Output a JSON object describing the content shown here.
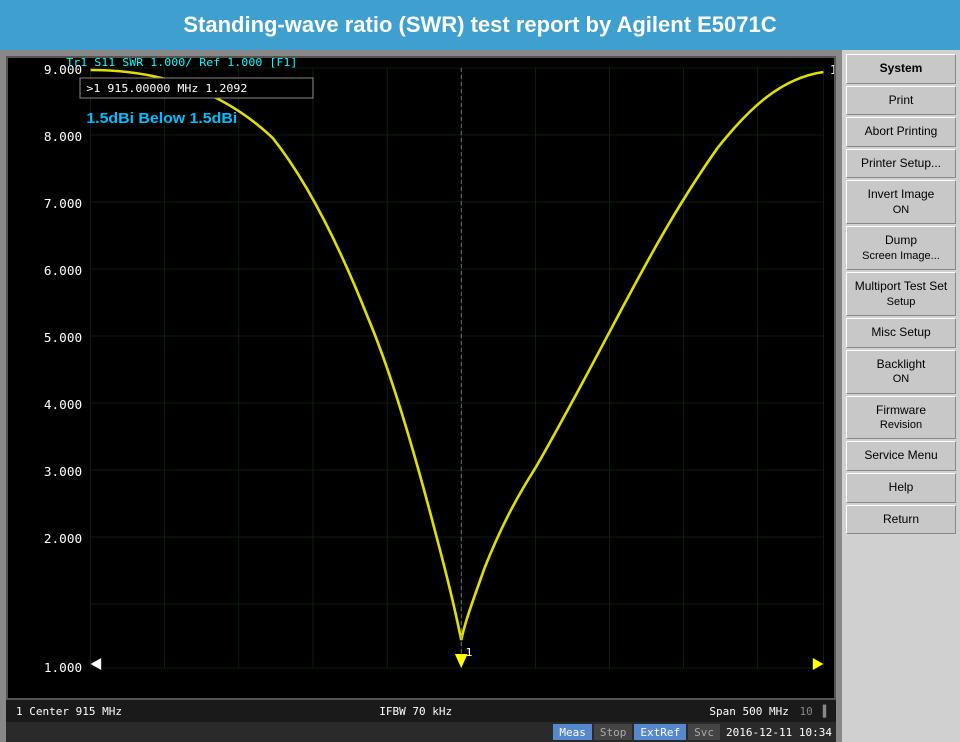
{
  "title": "Standing-wave ratio (SWR) test report by Agilent E5071C",
  "chart": {
    "header": "Tr1  S11  SWR 1.000/ Ref 1.000 [F1]",
    "marker_text": ">1   915.00000 MHz   1.2092",
    "annotation": "1.5dBi Below 1.5dBi",
    "y_labels": [
      "9.000",
      "8.000",
      "7.000",
      "6.000",
      "5.000",
      "4.000",
      "3.000",
      "2.000",
      "1.000"
    ],
    "footer_left": "1  Center 915 MHz",
    "footer_center": "IFBW 70 kHz",
    "footer_right": "Span 500 MHz"
  },
  "status_bar": {
    "meas_label": "Meas",
    "stop_label": "Stop",
    "extref_label": "ExtRef",
    "svc_label": "Svc",
    "timestamp": "2016-12-11 10:34"
  },
  "right_panel": {
    "buttons": [
      {
        "label": "System"
      },
      {
        "label": "Print"
      },
      {
        "label": "Abort Printing"
      },
      {
        "label": "Printer Setup..."
      },
      {
        "label": "Invert Image\nON"
      },
      {
        "label": "Dump\nScreen Image..."
      },
      {
        "label": "Multiport Test Set\nSetup"
      },
      {
        "label": "Misc Setup"
      },
      {
        "label": "Backlight\nON"
      },
      {
        "label": "Firmware\nRevision"
      },
      {
        "label": "Service Menu"
      },
      {
        "label": "Help"
      },
      {
        "label": "Return"
      }
    ]
  }
}
